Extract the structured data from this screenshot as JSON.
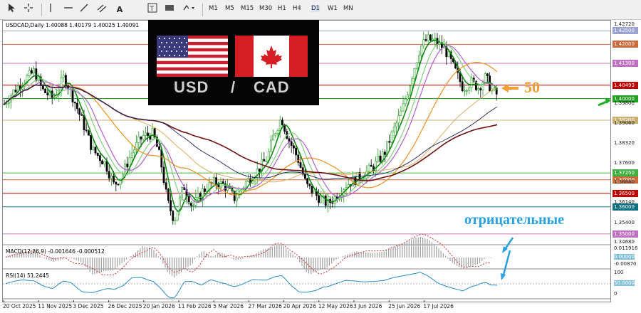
{
  "toolbar": {
    "timeframes": [
      "M1",
      "M5",
      "M15",
      "M30",
      "H1",
      "H4",
      "D1",
      "W1",
      "MN"
    ],
    "active_timeframe": "D1",
    "tools": [
      "cursor-icon",
      "crosshair-icon",
      "hline-icon",
      "trendline-icon",
      "channel-icon",
      "text-icon",
      "label-icon",
      "rectangle-icon",
      "shapes-icon"
    ]
  },
  "chart_data": {
    "type": "candlestick",
    "symbol_header": "USDCAD,Daily  1.40088 1.40179 1.40025 1.40091",
    "price_ticks": [
      "1.42720",
      "1.39800",
      "1.39060",
      "1.38320",
      "1.37600",
      "1.36880",
      "1.36140",
      "1.35400",
      "1.34680"
    ],
    "price_range": [
      1.3468,
      1.4272
    ],
    "levels": [
      {
        "value": "1.42500",
        "color": "#9aa2d0",
        "line": "#9aa2d0"
      },
      {
        "value": "1.42000",
        "color": "#cc6a3a",
        "line": "#cc6a3a"
      },
      {
        "value": "1.41300",
        "color": "#c070c0",
        "line": "#c070c0"
      },
      {
        "value": "1.40493",
        "color": "#c00000",
        "line": "#c00000"
      },
      {
        "value": "1.40000",
        "color": "#20a020",
        "line": "#20a020"
      },
      {
        "value": "1.39200",
        "color": "#c8b070",
        "line": "#c8b070"
      },
      {
        "value": "1.37250",
        "color": "#40b040",
        "line": "#40b040"
      },
      {
        "value": "1.37000",
        "color": "#cc6a3a",
        "line": "#cc6a3a"
      },
      {
        "value": "1.36500",
        "color": "#c00000",
        "line": "#c00000"
      },
      {
        "value": "1.36000",
        "color": "#107080",
        "line": "#107080"
      },
      {
        "value": "1.35000",
        "color": "#c070c0",
        "line": "#c070c0"
      }
    ],
    "date_labels": [
      "20 Oct 2025",
      "11 Nov 2025",
      "3 Dec 2025",
      "26 Dec 2025",
      "20 Jan 2026",
      "11 Feb 2026",
      "5 Mar 2026",
      "27 Mar 2026",
      "20 Apr 2026",
      "12 May 2026",
      "3 Jun 2026",
      "25 Jun 2026",
      "17 Jul 2026"
    ],
    "macd": {
      "label": "MACD(12,26,9) -0.001646 -0.000512",
      "ticks": [
        "0.011916",
        "0.00000",
        "-0.00870"
      ]
    },
    "rsi": {
      "label": "RSI(14) 51.2445",
      "ticks": [
        "100",
        "50.0000",
        "0"
      ]
    }
  },
  "overlay": {
    "usd": "USD",
    "slash": "/",
    "cad": "CAD",
    "fifty": "50",
    "negative_text": "отрицательные"
  },
  "colors": {
    "bull": "#20a020",
    "bear": "#000000",
    "ma_fast": "#108a10",
    "ma_lightgreen": "#80d080",
    "ma_purple": "#b060d0",
    "ma_orange": "#f09020",
    "ma_tan": "#d8b060",
    "ma_darkred": "#701010",
    "ma_navy": "#202060",
    "arrow_blue": "#2aa0e0",
    "arrow_orange": "#f0a030",
    "arrow_green": "#20b020"
  }
}
